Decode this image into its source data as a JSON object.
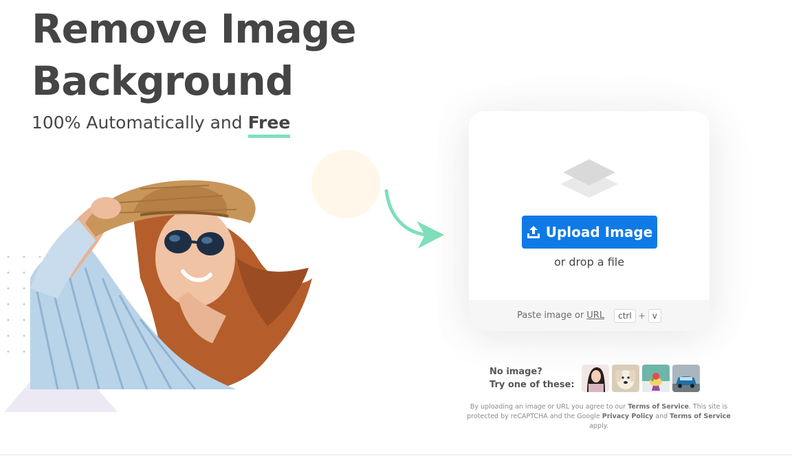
{
  "hero": {
    "title_line1": "Remove Image",
    "title_line2": "Background",
    "subtitle_prefix": "100% Automatically and",
    "subtitle_emphasis": "Free"
  },
  "upload": {
    "button_label": "Upload Image",
    "drop_text": "or drop a file",
    "paste_prefix": "Paste image or",
    "paste_link": "URL",
    "key_ctrl": "ctrl",
    "key_plus": "+",
    "key_v": "v"
  },
  "samples": {
    "label_line1": "No image?",
    "label_line2": "Try one of these:",
    "items": [
      "sample-woman",
      "sample-dog",
      "sample-cake",
      "sample-car"
    ]
  },
  "legal": {
    "part1": "By uploading an image or URL you agree to our",
    "terms1": "Terms of Service",
    "part2": ". This site is protected by reCAPTCHA and the Google",
    "privacy": "Privacy Policy",
    "part3": "and",
    "terms2": "Terms of Service",
    "part4": "apply."
  },
  "colors": {
    "accent_blue": "#0f7ae5",
    "underline_green": "#82e0bd",
    "arrow_green": "#7fdfb9",
    "text_dark": "#454545"
  },
  "icons": [
    "layers-icon",
    "upload-icon",
    "curved-arrow-icon"
  ]
}
